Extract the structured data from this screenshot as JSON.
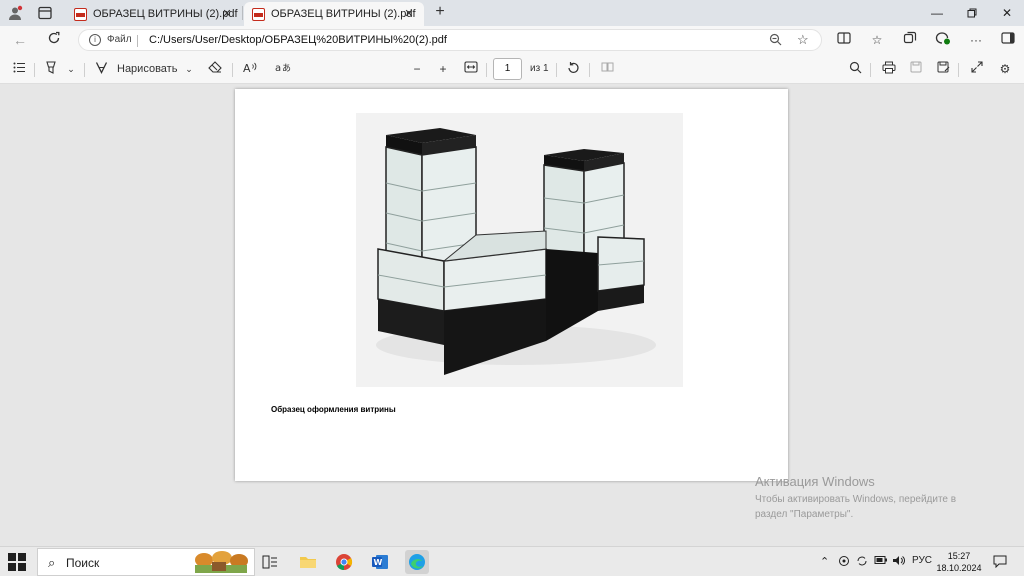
{
  "browser": {
    "tabs": [
      {
        "label": "ОБРАЗЕЦ ВИТРИНЫ (2).pdf",
        "active": false
      },
      {
        "label": "ОБРАЗЕЦ ВИТРИНЫ (2).pdf",
        "active": true
      }
    ],
    "address": {
      "scheme_label": "Файл",
      "url": "C:/Users/User/Desktop/ОБРАЗЕЦ%20ВИТРИНЫ%20(2).pdf"
    }
  },
  "pdf_toolbar": {
    "draw_label": "Нарисовать",
    "page_current": "1",
    "page_total": "из 1"
  },
  "document": {
    "caption": "Образец оформления витрины"
  },
  "watermark": {
    "title": "Активация Windows",
    "line1": "Чтобы активировать Windows, перейдите в",
    "line2": "раздел \"Параметры\"."
  },
  "taskbar": {
    "search_label": "Поиск",
    "language": "РУС",
    "time": "15:27",
    "date": "18.10.2024"
  },
  "colors": {
    "accent": "#0067c0",
    "pdf_red": "#c42b1c"
  }
}
